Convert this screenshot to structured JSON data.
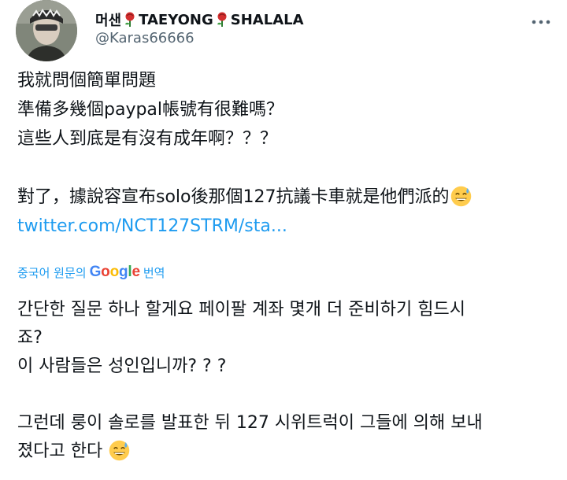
{
  "user": {
    "name_part1": "머샌",
    "name_part2": "TAEYONG",
    "name_part3": "SHALALA",
    "handle": "@Karas66666"
  },
  "tweet": {
    "line1": "我就問個簡單問題",
    "line2": "準備多幾個paypal帳號有很難嗎？",
    "line3": "這些人到底是有沒有成年啊？？？",
    "line4": "對了，據說容宣布solo後那個127抗議卡車就是他們派的",
    "link": "twitter.com/NCT127STRM/sta..."
  },
  "translation": {
    "source_label": "중국어 원문의",
    "google": "Google",
    "action_label": "번역",
    "line1": "간단한 질문 하나 할게요 페이팔 계좌 몇개 더 준비하기 힘드시",
    "line2": "죠?",
    "line3": "이 사람들은 성인입니까? ? ?",
    "line4": "그런데 룽이 솔로를 발표한 뒤 127 시위트럭이 그들에 의해 보내",
    "line5": "졌다고 한다"
  },
  "icons": {
    "more": "more-horizontal-icon",
    "rose": "rose-emoji",
    "sweat_smile": "sweat-smile-emoji"
  },
  "colors": {
    "text": "#0f1419",
    "secondary": "#536471",
    "link": "#1d9bf0"
  }
}
